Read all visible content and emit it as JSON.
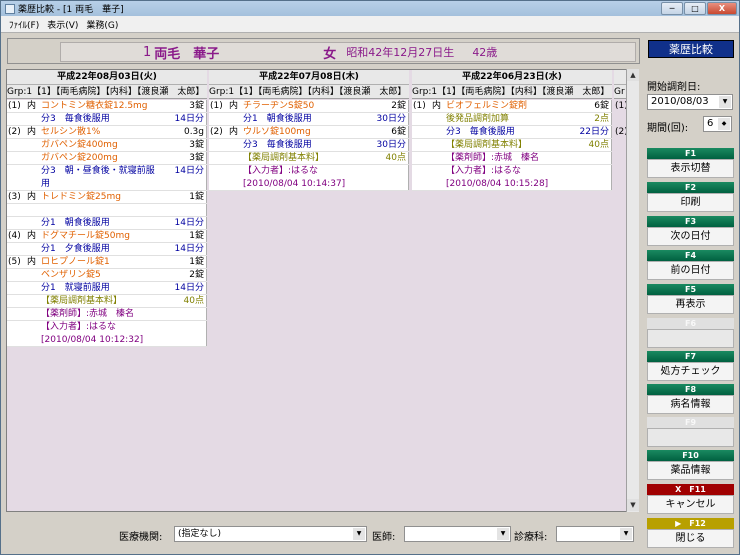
{
  "window": {
    "title": "薬歴比較 - [1 両毛　華子]",
    "min_label": "─",
    "max_label": "□",
    "close_label": "X"
  },
  "menu": [
    "ﾌｧｲﾙ(F)",
    "表示(V)",
    "業務(G)"
  ],
  "patient": {
    "id": "1",
    "name": "両毛　華子",
    "sex": "女",
    "dob": "昭和42年12月27日生",
    "age": "42歳"
  },
  "columns": [
    {
      "date": "平成22年08月03日(火)",
      "grp": "Grp:1",
      "header": "【1】【両毛病院】【内科】【渡良瀬　太郎】",
      "rows": [
        {
          "g": "(1)",
          "k": "内",
          "text": "コントミン糖衣錠12.5mg",
          "val": "3錠",
          "c": "orange"
        },
        {
          "g": "",
          "k": "",
          "text": "分3　毎食後服用",
          "val": "14日分",
          "c": "blue"
        },
        {
          "g": "(2)",
          "k": "内",
          "text": "セルシン散1%",
          "val": "0.3g",
          "c": "orange"
        },
        {
          "g": "",
          "k": "",
          "text": "ガバペン錠400mg",
          "val": "3錠",
          "c": "orange"
        },
        {
          "g": "",
          "k": "",
          "text": "ガバペン錠200mg",
          "val": "3錠",
          "c": "orange"
        },
        {
          "g": "",
          "k": "",
          "text": "分3　朝・昼食後・就寝前服",
          "text2": "用",
          "val": "14日分",
          "c": "blue"
        },
        {
          "g": "(3)",
          "k": "内",
          "text": "トレドミン錠25mg",
          "val": "1錠",
          "c": "orange"
        },
        {
          "g": "",
          "k": "",
          "text": "",
          "val": "",
          "c": "blue"
        },
        {
          "g": "",
          "k": "",
          "text": "分1　朝食後服用",
          "val": "14日分",
          "c": "blue"
        },
        {
          "g": "(4)",
          "k": "内",
          "text": "ドグマチール錠50mg",
          "val": "1錠",
          "c": "orange"
        },
        {
          "g": "",
          "k": "",
          "text": "分1　夕食後服用",
          "val": "14日分",
          "c": "blue"
        },
        {
          "g": "(5)",
          "k": "内",
          "text": "ロヒプノール錠1",
          "val": "1錠",
          "c": "orange"
        },
        {
          "g": "",
          "k": "",
          "text": "ベンザリン錠5",
          "val": "2錠",
          "c": "orange"
        },
        {
          "g": "",
          "k": "",
          "text": "分1　就寝前服用",
          "val": "14日分",
          "c": "blue"
        },
        {
          "g": "",
          "k": "",
          "text": "【薬局調剤基本料】",
          "val": "40点",
          "c": "olive"
        },
        {
          "g": "",
          "k": "",
          "text": "【薬剤師】:赤城　榛名",
          "val": "",
          "c": "purple"
        },
        {
          "g": "",
          "k": "",
          "text": "【入力者】:はるな",
          "text2": "[2010/08/04 10:12:32]",
          "val": "",
          "c": "purple"
        }
      ]
    },
    {
      "date": "平成22年07月08日(木)",
      "grp": "Grp:1",
      "header": "【1】【両毛病院】【内科】【渡良瀬　太郎】",
      "rows": [
        {
          "g": "(1)",
          "k": "内",
          "text": "チラーヂンS錠50",
          "val": "2錠",
          "c": "orange"
        },
        {
          "g": "",
          "k": "",
          "text": "分1　朝食後服用",
          "val": "30日分",
          "c": "blue"
        },
        {
          "g": "(2)",
          "k": "内",
          "text": "ウルソ錠100mg",
          "val": "6錠",
          "c": "orange"
        },
        {
          "g": "",
          "k": "",
          "text": "分3　毎食後服用",
          "val": "30日分",
          "c": "blue"
        },
        {
          "g": "",
          "k": "",
          "text": "【薬局調剤基本料】",
          "val": "40点",
          "c": "olive"
        },
        {
          "g": "",
          "k": "",
          "text": "【入力者】:はるな",
          "text2": "[2010/08/04 10:14:37]",
          "val": "",
          "c": "purple"
        }
      ]
    },
    {
      "date": "平成22年06月23日(水)",
      "grp": "Grp:1",
      "header": "【1】【両毛病院】【内科】【渡良瀬　太郎】",
      "rows": [
        {
          "g": "(1)",
          "k": "内",
          "text": "ビオフェルミン錠剤",
          "val": "6錠",
          "c": "orange"
        },
        {
          "g": "",
          "k": "",
          "text": "後発品調剤加算",
          "val": "2点",
          "c": "olive"
        },
        {
          "g": "",
          "k": "",
          "text": "分3　毎食後服用",
          "val": "22日分",
          "c": "blue"
        },
        {
          "g": "",
          "k": "",
          "text": "【薬局調剤基本料】",
          "val": "40点",
          "c": "olive"
        },
        {
          "g": "",
          "k": "",
          "text": "【薬剤師】:赤城　榛名",
          "val": "",
          "c": "purple"
        },
        {
          "g": "",
          "k": "",
          "text": "【入力者】:はるな",
          "text2": "[2010/08/04 10:15:28]",
          "val": "",
          "c": "purple"
        }
      ]
    }
  ],
  "fourth_col": {
    "grp": "Gr",
    "g1": "(1)",
    "g2": "(2)"
  },
  "right_panel": {
    "title": "薬歴比較",
    "start_label": "開始調剤日:",
    "start_date": "2010/08/03",
    "period_label": "期間(回):",
    "period_value": "6",
    "keys": [
      {
        "key": "F1",
        "label": "表示切替"
      },
      {
        "key": "F2",
        "label": "印刷"
      },
      {
        "key": "F3",
        "label": "次の日付"
      },
      {
        "key": "F4",
        "label": "前の日付"
      },
      {
        "key": "F5",
        "label": "再表示"
      },
      {
        "key": "F6",
        "label": ""
      },
      {
        "key": "F7",
        "label": "処方チェック"
      },
      {
        "key": "F8",
        "label": "病名情報"
      },
      {
        "key": "F9",
        "label": ""
      },
      {
        "key": "F10",
        "label": "薬品情報"
      },
      {
        "key": "X　F11",
        "label": "キャンセル"
      },
      {
        "key": "▶　F12",
        "label": "閉じる"
      }
    ]
  },
  "bottom": {
    "institution_label": "医療機関:",
    "institution_value": "(指定なし)",
    "doctor_label": "医師:",
    "doctor_value": "",
    "dept_label": "診療科:",
    "dept_value": ""
  }
}
